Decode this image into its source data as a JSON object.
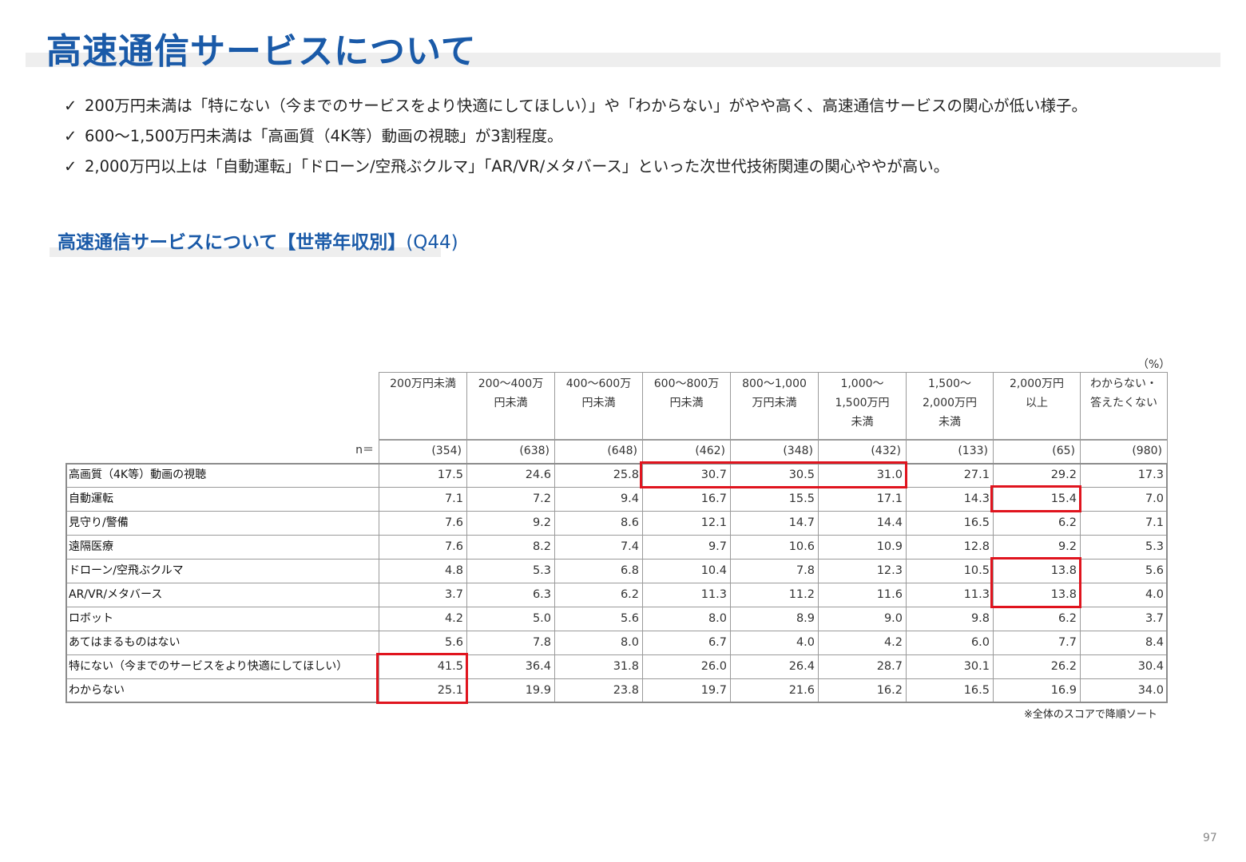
{
  "page": {
    "title": "高速通信サービスについて",
    "bullets": [
      "200万円未満は「特にない（今までのサービスをより快適にしてほしい）」や「わからない」がやや高く、高速通信サービスの関心が低い様子。",
      "600～1,500万円未満は「高画質（4K等）動画の視聴」が3割程度。",
      "2,000万円以上は「自動運転」「ドローン/空飛ぶクルマ」「AR/VR/メタバース」といった次世代技術関連の関心ややが高い。"
    ],
    "check_mark": "✓",
    "subtitle": "高速通信サービスについて【世帯年収別】",
    "subtitle_q": "(Q44)",
    "unit": "（%）",
    "note": "※全体のスコアで降順ソート",
    "page_number": "97"
  },
  "table": {
    "n_label": "n＝",
    "columns": [
      {
        "l1": "200万円未満",
        "l2": "",
        "l3": "",
        "n": "(354)"
      },
      {
        "l1": "200～400万",
        "l2": "円未満",
        "l3": "",
        "n": "(638)"
      },
      {
        "l1": "400～600万",
        "l2": "円未満",
        "l3": "",
        "n": "(648)"
      },
      {
        "l1": "600～800万",
        "l2": "円未満",
        "l3": "",
        "n": "(462)"
      },
      {
        "l1": "800～1,000",
        "l2": "万円未満",
        "l3": "",
        "n": "(348)"
      },
      {
        "l1": "1,000～",
        "l2": "1,500万円",
        "l3": "未満",
        "n": "(432)"
      },
      {
        "l1": "1,500～",
        "l2": "2,000万円",
        "l3": "未満",
        "n": "(133)"
      },
      {
        "l1": "2,000万円",
        "l2": "以上",
        "l3": "",
        "n": "(65)"
      },
      {
        "l1": "わからない・",
        "l2": "答えたくない",
        "l3": "",
        "n": "(980)"
      }
    ],
    "rows": [
      {
        "label": "高画質（4K等）動画の視聴",
        "values": [
          "17.5",
          "24.6",
          "25.8",
          "30.7",
          "30.5",
          "31.0",
          "27.1",
          "29.2",
          "17.3"
        ]
      },
      {
        "label": "自動運転",
        "values": [
          "7.1",
          "7.2",
          "9.4",
          "16.7",
          "15.5",
          "17.1",
          "14.3",
          "15.4",
          "7.0"
        ]
      },
      {
        "label": "見守り/警備",
        "values": [
          "7.6",
          "9.2",
          "8.6",
          "12.1",
          "14.7",
          "14.4",
          "16.5",
          "6.2",
          "7.1"
        ]
      },
      {
        "label": "遠隔医療",
        "values": [
          "7.6",
          "8.2",
          "7.4",
          "9.7",
          "10.6",
          "10.9",
          "12.8",
          "9.2",
          "5.3"
        ]
      },
      {
        "label": "ドローン/空飛ぶクルマ",
        "values": [
          "4.8",
          "5.3",
          "6.8",
          "10.4",
          "7.8",
          "12.3",
          "10.5",
          "13.8",
          "5.6"
        ]
      },
      {
        "label": "AR/VR/メタバース",
        "values": [
          "3.7",
          "6.3",
          "6.2",
          "11.3",
          "11.2",
          "11.6",
          "11.3",
          "13.8",
          "4.0"
        ]
      },
      {
        "label": "ロボット",
        "values": [
          "4.2",
          "5.0",
          "5.6",
          "8.0",
          "8.9",
          "9.0",
          "9.8",
          "6.2",
          "3.7"
        ]
      },
      {
        "label": "あてはまるものはない",
        "values": [
          "5.6",
          "7.8",
          "8.0",
          "6.7",
          "4.0",
          "4.2",
          "6.0",
          "7.7",
          "8.4"
        ]
      },
      {
        "label": "特にない（今までのサービスをより快適にしてほしい）",
        "values": [
          "41.5",
          "36.4",
          "31.8",
          "26.0",
          "26.4",
          "28.7",
          "30.1",
          "26.2",
          "30.4"
        ]
      },
      {
        "label": "わからない",
        "values": [
          "25.1",
          "19.9",
          "23.8",
          "19.7",
          "21.6",
          "16.2",
          "16.5",
          "16.9",
          "34.0"
        ]
      }
    ],
    "highlight_color": "#e0141e",
    "highlights": [
      {
        "row_start": 0,
        "row_end": 0,
        "col_start": 3,
        "col_end": 5
      },
      {
        "row_start": 1,
        "row_end": 1,
        "col_start": 7,
        "col_end": 7
      },
      {
        "row_start": 4,
        "row_end": 5,
        "col_start": 7,
        "col_end": 7
      },
      {
        "row_start": 8,
        "row_end": 9,
        "col_start": 0,
        "col_end": 0
      }
    ]
  }
}
